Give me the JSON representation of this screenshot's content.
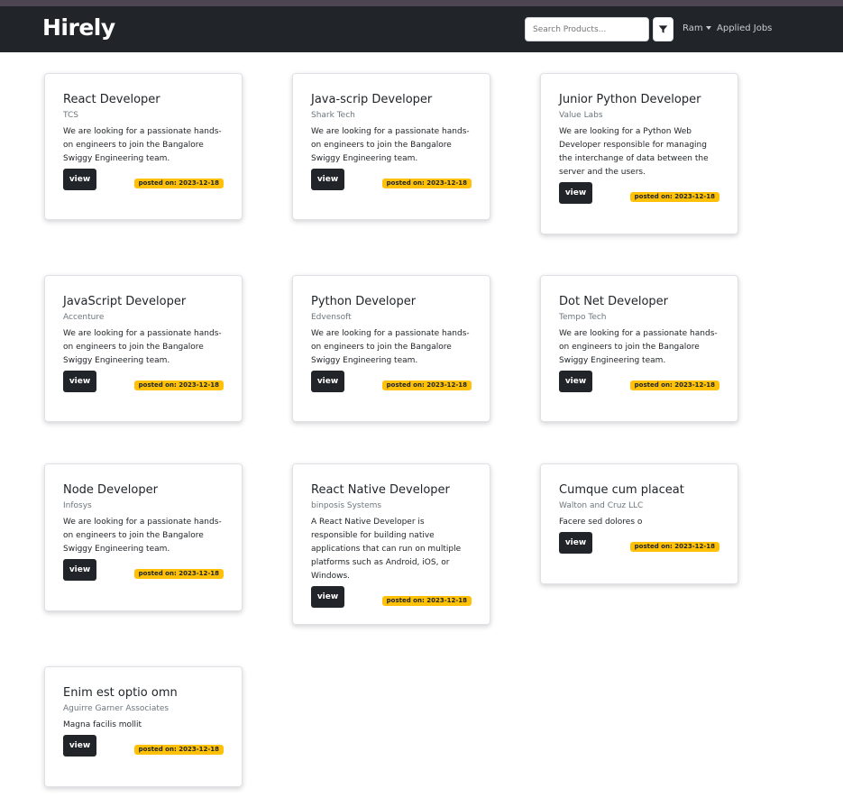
{
  "app": {
    "brand": "Hirely"
  },
  "navbar": {
    "search_placeholder": "Search Products...",
    "filter_icon": "filter-icon",
    "user_label": "Ram",
    "applied_jobs_label": "Applied Jobs"
  },
  "colors": {
    "navbar_bg": "#212529",
    "button_bg": "#212529",
    "badge_bg": "#ffc107"
  },
  "jobs": [
    {
      "title": "React Developer",
      "company": "TCS",
      "description": "We are looking for a passionate hands-on engineers to join the Bangalore Swiggy Engineering team.",
      "button": "view",
      "posted": "posted on: 2023-12-18"
    },
    {
      "title": "Java-scrip Developer",
      "company": "Shark Tech",
      "description": "We are looking for a passionate hands-on engineers to join the Bangalore Swiggy Engineering team.",
      "button": "view",
      "posted": "posted on: 2023-12-18"
    },
    {
      "title": "Junior Python Developer",
      "company": "Value Labs",
      "description": "We are looking for a Python Web Developer responsible for managing the interchange of data between the server and the users.",
      "button": "view",
      "posted": "posted on: 2023-12-18"
    },
    {
      "title": "JavaScript Developer",
      "company": "Accenture",
      "description": "We are looking for a passionate hands-on engineers to join the Bangalore Swiggy Engineering team.",
      "button": "view",
      "posted": "posted on: 2023-12-18"
    },
    {
      "title": "Python Developer",
      "company": "Edvensoft",
      "description": "We are looking for a passionate hands-on engineers to join the Bangalore Swiggy Engineering team.",
      "button": "view",
      "posted": "posted on: 2023-12-18"
    },
    {
      "title": "Dot Net Developer",
      "company": "Tempo Tech",
      "description": "We are looking for a passionate hands-on engineers to join the Bangalore Swiggy Engineering team.",
      "button": "view",
      "posted": "posted on: 2023-12-18"
    },
    {
      "title": "Node Developer",
      "company": "Infosys",
      "description": "We are looking for a passionate hands-on engineers to join the Bangalore Swiggy Engineering team.",
      "button": "view",
      "posted": "posted on: 2023-12-18"
    },
    {
      "title": "React Native Developer",
      "company": "binposis Systems",
      "description": "A React Native Developer is responsible for building native applications that can run on multiple platforms such as Android, iOS, or Windows.",
      "button": "view",
      "posted": "posted on: 2023-12-18"
    },
    {
      "title": "Cumque cum placeat",
      "company": "Walton and Cruz LLC",
      "description": "Facere sed dolores o",
      "button": "view",
      "posted": "posted on: 2023-12-18"
    },
    {
      "title": "Enim est optio omn",
      "company": "Aguirre Garner Associates",
      "description": "Magna facilis mollit",
      "button": "view",
      "posted": "posted on: 2023-12-18"
    }
  ]
}
